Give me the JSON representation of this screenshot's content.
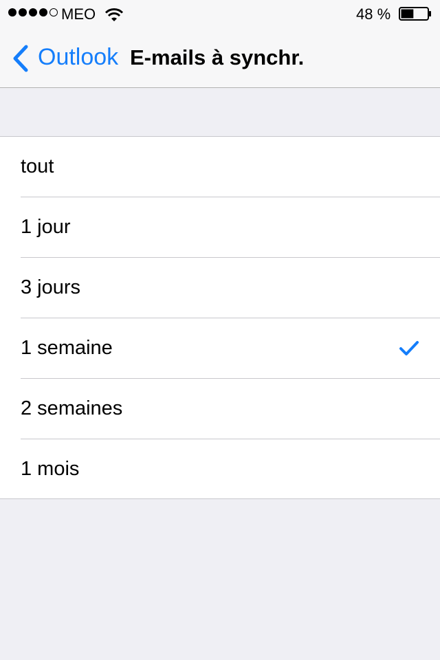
{
  "status_bar": {
    "signal_bars_filled": 4,
    "signal_bars_total": 5,
    "carrier": "MEO",
    "wifi_icon": "wifi-icon",
    "battery_percent_label": "48 %",
    "battery_level": 0.48
  },
  "nav": {
    "back_label": "Outlook",
    "back_icon": "chevron-left-icon",
    "title": "E-mails à synchr."
  },
  "options": [
    {
      "label": "tout",
      "selected": false
    },
    {
      "label": "1 jour",
      "selected": false
    },
    {
      "label": "3 jours",
      "selected": false
    },
    {
      "label": "1 semaine",
      "selected": true
    },
    {
      "label": "2 semaines",
      "selected": false
    },
    {
      "label": "1 mois",
      "selected": false
    }
  ],
  "colors": {
    "accent": "#157efb",
    "background": "#efeff4",
    "separator": "#c8c7cc"
  }
}
